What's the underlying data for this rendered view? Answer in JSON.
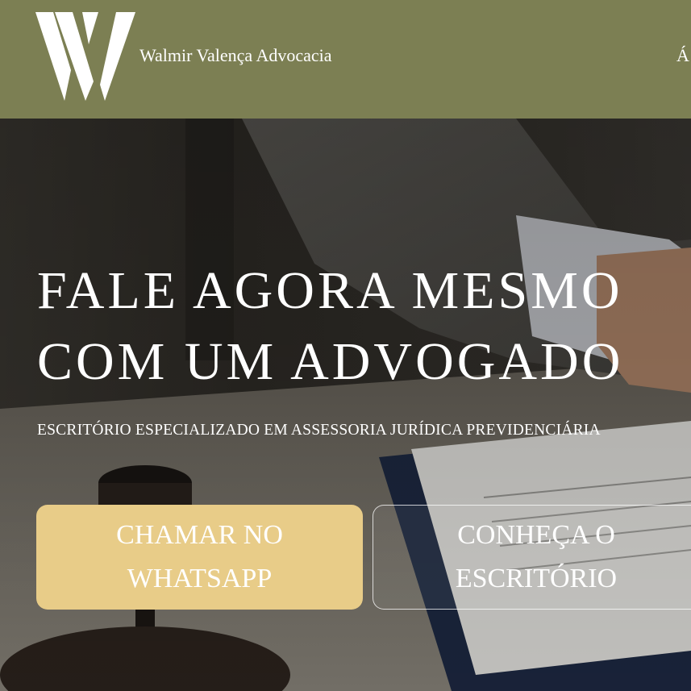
{
  "header": {
    "brand_name": "Walmir Valença Advocacia",
    "nav_partial": "Á",
    "logo_icon": "w-monogram-icon",
    "background_color": "#7c7f53"
  },
  "hero": {
    "title_line_1": "FALE AGORA MESMO",
    "title_line_2": "COM UM ADVOGADO",
    "subtitle": "ESCRITÓRIO ESPECIALIZADO EM ASSESSORIA JURÍDICA PREVIDENCIÁRIA",
    "primary_button": {
      "line_1": "CHAMAR NO",
      "line_2": "WHATSAPP",
      "color": "#e8cc88"
    },
    "secondary_button": {
      "line_1": "CONHEÇA O",
      "line_2": "ESCRITÓRIO"
    }
  }
}
